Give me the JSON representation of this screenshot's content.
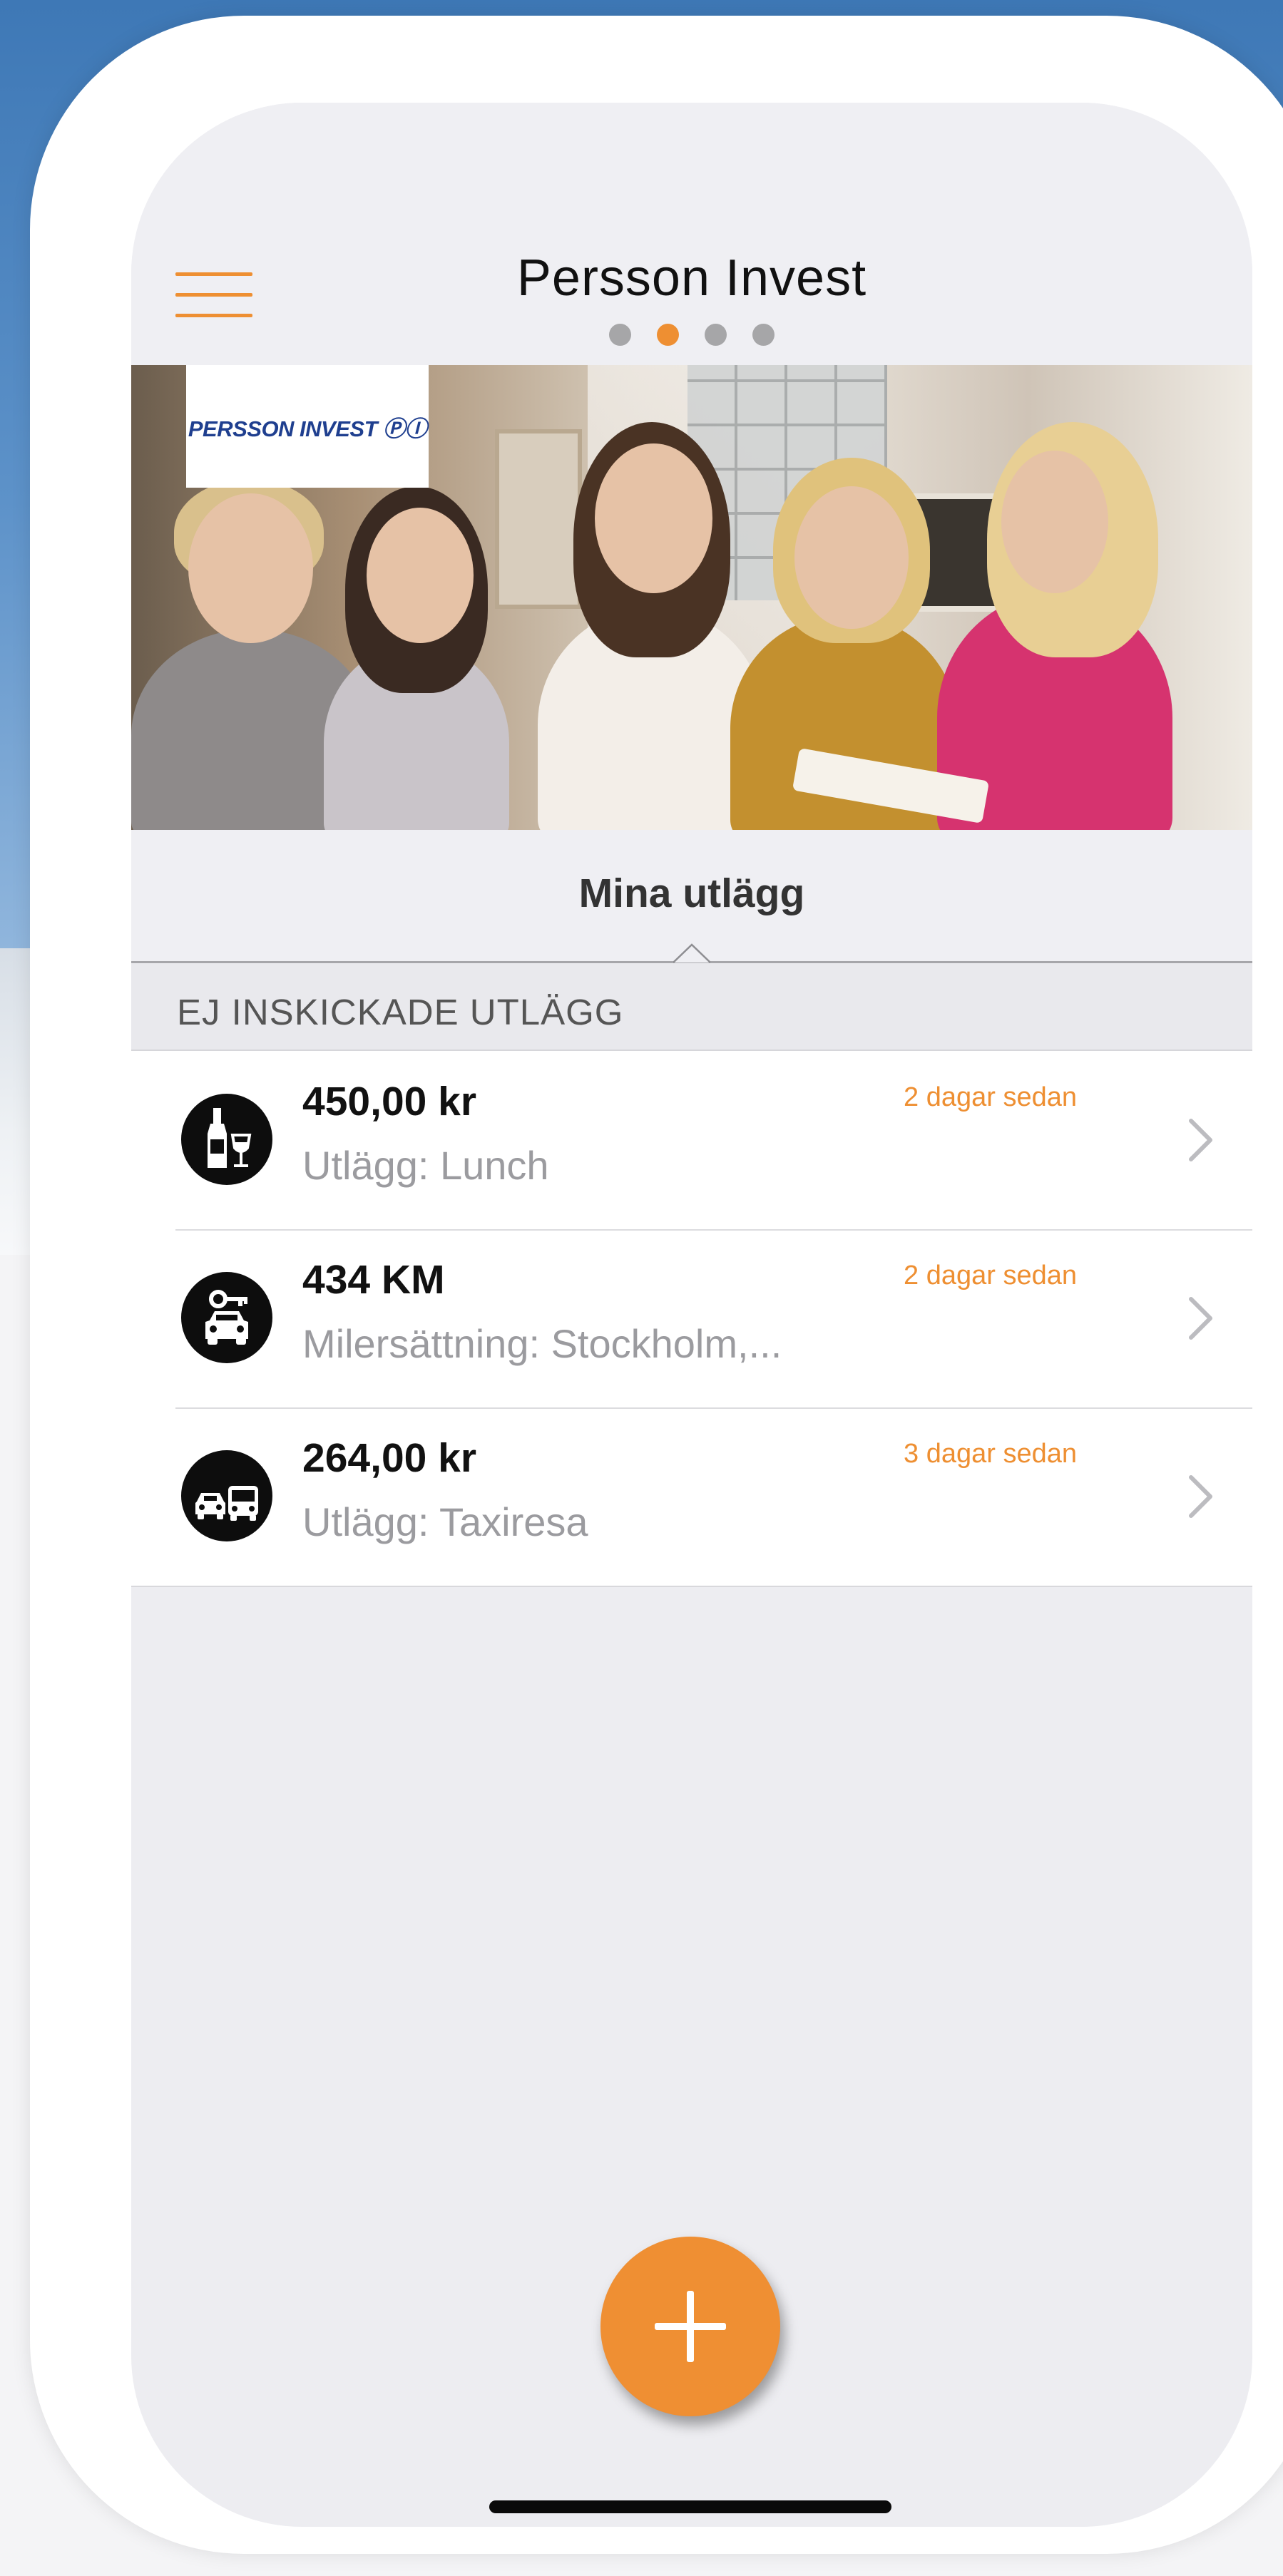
{
  "app": {
    "title": "Persson Invest"
  },
  "header": {
    "menu_icon": "hamburger-menu-icon",
    "pager": {
      "count": 4,
      "active_index": 1
    }
  },
  "banner": {
    "logo_text": "PERSSON INVEST ⓅⒾ"
  },
  "tab": {
    "label": "Mina utlägg"
  },
  "section": {
    "label": "EJ INSKICKADE UTLÄGG"
  },
  "expenses": [
    {
      "icon": "wine-bottle-glass-icon",
      "amount": "450,00 kr",
      "description": "Utlägg: Lunch",
      "time": "2 dagar sedan"
    },
    {
      "icon": "car-key-icon",
      "amount": "434 KM",
      "description": "Milersättning: Stockholm,...",
      "time": "2 dagar sedan"
    },
    {
      "icon": "car-bus-icon",
      "amount": "264,00 kr",
      "description": "Utlägg: Taxiresa",
      "time": "3 dagar sedan"
    }
  ],
  "fab": {
    "icon": "plus-icon"
  },
  "colors": {
    "accent": "#EE8F32",
    "title": "#111111",
    "muted": "#9B9B9F",
    "screen_bg": "#EDEDF1"
  }
}
